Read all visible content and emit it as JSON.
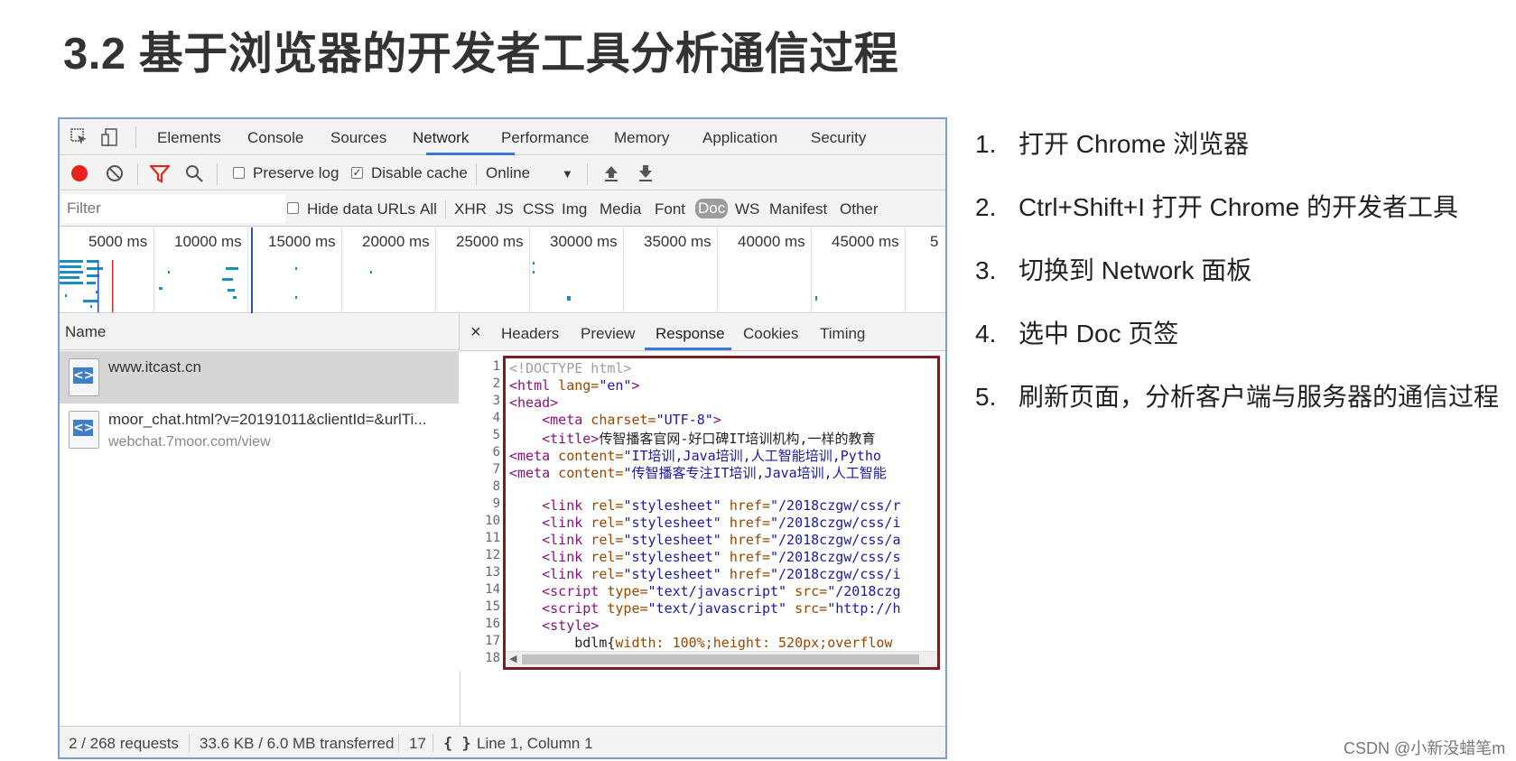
{
  "slide": {
    "title": "3.2 基于浏览器的开发者工具分析通信过程"
  },
  "devtools": {
    "tabs": [
      "Elements",
      "Console",
      "Sources",
      "Network",
      "Performance",
      "Memory",
      "Application",
      "Security"
    ],
    "active_tab": "Network",
    "toolbar": {
      "preserve_log": "Preserve log",
      "preserve_log_checked": false,
      "disable_cache": "Disable cache",
      "disable_cache_checked": true,
      "throttle": "Online"
    },
    "filter": {
      "placeholder": "Filter",
      "hide_data_urls": "Hide data URLs",
      "types": [
        "All",
        "XHR",
        "JS",
        "CSS",
        "Img",
        "Media",
        "Font",
        "Doc",
        "WS",
        "Manifest",
        "Other"
      ],
      "active_type": "Doc"
    },
    "overview": {
      "ticks": [
        "5000 ms",
        "10000 ms",
        "15000 ms",
        "20000 ms",
        "25000 ms",
        "30000 ms",
        "35000 ms",
        "40000 ms",
        "45000 ms",
        "5"
      ]
    },
    "requests": {
      "column": "Name",
      "items": [
        {
          "name": "www.itcast.cn",
          "url": ""
        },
        {
          "name": "moor_chat.html?v=20191011&clientId=&urlTi...",
          "url": "webchat.7moor.com/view"
        }
      ]
    },
    "detail": {
      "close": "×",
      "tabs": [
        "Headers",
        "Preview",
        "Response",
        "Cookies",
        "Timing"
      ],
      "active_tab": "Response",
      "line_numbers": [
        "1",
        "2",
        "3",
        "4",
        "5",
        "6",
        "7",
        "8",
        "9",
        "10",
        "11",
        "12",
        "13",
        "14",
        "15",
        "16",
        "17",
        "18"
      ],
      "code": {
        "l1": "<!DOCTYPE html>",
        "l2_tag": "<html",
        "l2_attr": " lang=",
        "l2_val": "\"en\"",
        "l2_end": ">",
        "l3": "<head>",
        "l4_tag": "    <meta",
        "l4_attr": " charset=",
        "l4_val": "\"UTF-8\"",
        "l4_end": ">",
        "l5_tag": "    <title>",
        "l5_text": "传智播客官网-好口碑IT培训机构,一样的教育",
        "l6_tag": "<meta",
        "l6_attr": " content=",
        "l6_val": "\"IT培训,Java培训,人工智能培训,Pytho",
        "l7_tag": "<meta",
        "l7_attr": " content=",
        "l7_val": "\"传智播客专注IT培训,Java培训,人工智能",
        "link_tag": "    <link",
        "link_rel": " rel=",
        "link_rel_val": "\"stylesheet\"",
        "link_href": " href=",
        "l9_val": "\"/2018czgw/css/r",
        "l10_val": "\"/2018czgw/css/i",
        "l11_val": "\"/2018czgw/css/a",
        "l12_val": "\"/2018czgw/css/s",
        "l13_val": "\"/2018czgw/css/i",
        "script_tag": "    <script",
        "script_type": " type=",
        "script_type_val": "\"text/javascript\"",
        "script_src": " src=",
        "l14_val": "\"/2018czg",
        "l15_val": "\"http://h",
        "l16": "    <style>",
        "l17_sel": "        bdlm{",
        "l17_prop": "width: 100%;height: 520px;overflow"
      },
      "status": "Line 1, Column 1",
      "braces": "{ }"
    },
    "statusbar": {
      "requests": "2 / 268 requests",
      "transferred": "33.6 KB / 6.0 MB transferred",
      "count": "17"
    }
  },
  "steps": [
    {
      "num": "1.",
      "text": "打开 Chrome 浏览器"
    },
    {
      "num": "2.",
      "text": "Ctrl+Shift+I 打开 Chrome 的开发者工具"
    },
    {
      "num": "3.",
      "text": "切换到 Network 面板"
    },
    {
      "num": "4.",
      "text": "选中 Doc 页签"
    },
    {
      "num": "5.",
      "text": "刷新页面，分析客户端与服务器的通信过程"
    }
  ],
  "watermark": "CSDN @小新没蜡笔m",
  "colors": {
    "accent": "#3879d9",
    "record": "#e8231a",
    "highlight_border": "#7a1f1f",
    "panel_border": "#7a9fd0"
  }
}
